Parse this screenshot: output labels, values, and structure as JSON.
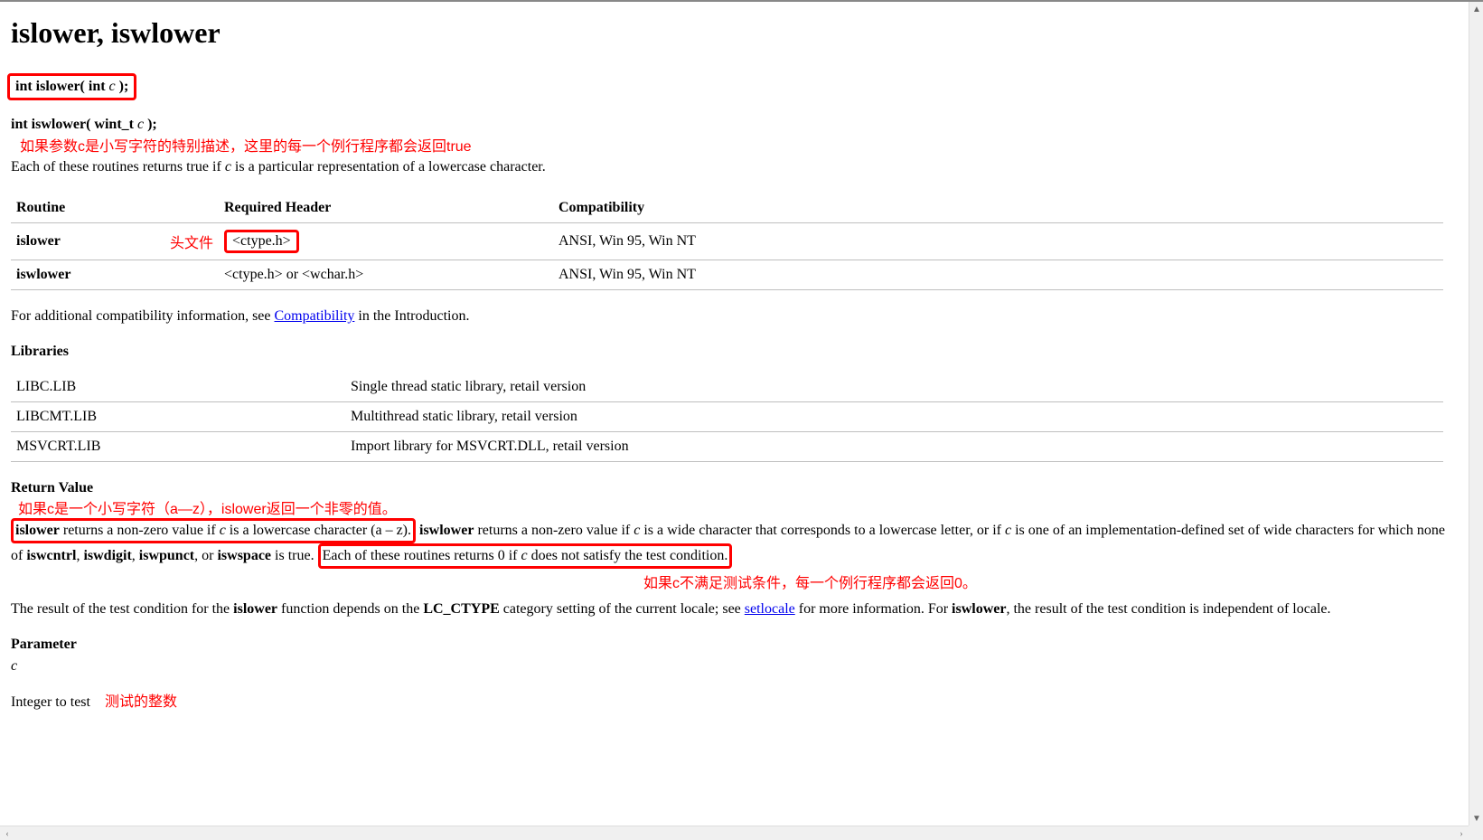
{
  "title": "islower, iswlower",
  "signatures": {
    "sig1_pre": "int islower( int ",
    "sig1_param": "c",
    "sig1_post": " );",
    "sig2_pre": "int iswlower( wint_t ",
    "sig2_param": "c",
    "sig2_post": " );"
  },
  "annotations": {
    "desc_above": "如果参数c是小写字符的特别描述，这里的每一个例行程序都会返回true",
    "header_label": "头文件",
    "rv_above": "如果c是一个小写字符（a—z），islower返回一个非零的值。",
    "rv_below": "如果c不满足测试条件，每一个例行程序都会返回0。",
    "param_note": "测试的整数"
  },
  "description": {
    "pre": "Each of these routines returns true if ",
    "param": "c",
    "post": " is a particular representation of a lowercase character."
  },
  "routine_table": {
    "headers": {
      "c1": "Routine",
      "c2": "Required Header",
      "c3": "Compatibility"
    },
    "rows": [
      {
        "routine": "islower",
        "header": "<ctype.h>",
        "compat": "ANSI, Win 95, Win NT",
        "boxed": true
      },
      {
        "routine": "iswlower",
        "header": "<ctype.h> or <wchar.h>",
        "compat": "ANSI, Win 95, Win NT",
        "boxed": false
      }
    ]
  },
  "compat_line": {
    "pre": "For additional compatibility information, see ",
    "link": "Compatibility",
    "post": " in the Introduction."
  },
  "libraries_heading": "Libraries",
  "lib_table": {
    "rows": [
      {
        "name": "LIBC.LIB",
        "desc": "Single thread static library, retail version"
      },
      {
        "name": "LIBCMT.LIB",
        "desc": "Multithread static library, retail version"
      },
      {
        "name": "MSVCRT.LIB",
        "desc": "Import library for MSVCRT.DLL, retail version"
      }
    ]
  },
  "return_value_heading": "Return Value",
  "rv": {
    "b1": "islower",
    "t1": " returns a non-zero value if ",
    "p1": "c",
    "t2": " is a lowercase character (a – z).",
    "b2": " iswlower",
    "t3": " returns a non-zero value if ",
    "p2": "c",
    "t4": " is a wide character that corresponds to a lowercase letter, or if ",
    "p3": "c",
    "t5": " is one of an implementation-defined set of wide characters for which none of ",
    "b3": "iswcntrl",
    "t6": ", ",
    "b4": "iswdigit",
    "t7": ", ",
    "b5": "iswpunct",
    "t8": ", or ",
    "b6": "iswspace",
    "t9": " is true. ",
    "box2": "Each of these routines returns 0 if ",
    "p4": "c",
    "box2b": " does not satisfy the test condition."
  },
  "locale": {
    "t1": "The result of the test condition for the ",
    "b1": "islower",
    "t2": " function depends on the ",
    "b2": "LC_CTYPE",
    "t3": " category setting of the current locale; see ",
    "link": "setlocale",
    "t4": " for more information. For ",
    "b3": "iswlower",
    "t5": ", the result of the test condition is independent of locale."
  },
  "parameter_heading": "Parameter",
  "parameter_name": "c",
  "parameter_desc": "Integer to test"
}
